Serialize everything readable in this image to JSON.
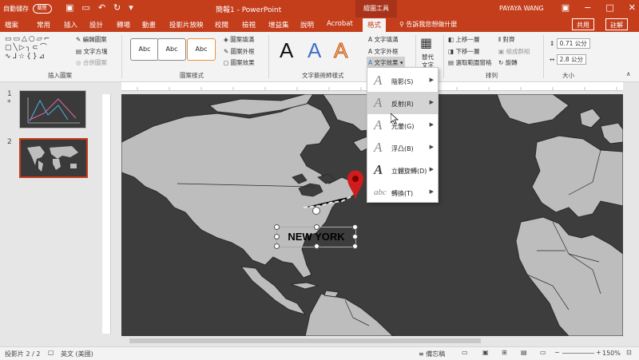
{
  "titlebar": {
    "autosave_label": "自動儲存",
    "autosave_state": "關閉",
    "doc_title": "簡報1  -  PowerPoint",
    "context_tab": "繪圖工具",
    "user": "PAYAYA WANG"
  },
  "tabs": [
    "檔案",
    "常用",
    "插入",
    "設計",
    "轉場",
    "動畫",
    "投影片放映",
    "校閱",
    "檢視",
    "增益集",
    "說明",
    "Acrobat",
    "格式"
  ],
  "active_tab": "格式",
  "tell_me": "告訴我您想做什麼",
  "share_label": "共用",
  "comment_label": "註解",
  "ribbon": {
    "insert_shapes": {
      "edit_shape": "編輯圖案",
      "text_box": "文字方塊",
      "merge_shapes": "合併圖案",
      "label": "插入圖案"
    },
    "shape_styles": {
      "sample": "Abc",
      "fill": "圖案填滿",
      "outline": "圖案外框",
      "effects": "圖案效果",
      "label": "圖案樣式"
    },
    "wordart": {
      "sample": "A",
      "text_fill": "文字填滿",
      "text_outline": "文字外框",
      "text_effects": "文字效果",
      "label": "文字藝術師樣式"
    },
    "accessibility": {
      "alt_text_1": "替代",
      "alt_text_2": "文字"
    },
    "arrange": {
      "bring_forward": "上移一層",
      "send_backward": "下移一層",
      "selection_pane": "選取範圍窗格",
      "align": "對齊",
      "group": "組成群組",
      "rotate": "旋轉",
      "label": "排列"
    },
    "size": {
      "height": "0.71 公分",
      "width": "2.8 公分",
      "label": "大小"
    }
  },
  "effects_menu": [
    {
      "label": "陰影(S)"
    },
    {
      "label": "反射(R)"
    },
    {
      "label": "光暈(G)"
    },
    {
      "label": "浮凸(B)"
    },
    {
      "label": "立體旋轉(D)"
    },
    {
      "label": "轉換(T)"
    }
  ],
  "slides": [
    {
      "number": "1",
      "marker": "*"
    },
    {
      "number": "2"
    }
  ],
  "slide_label": "NEW YORK",
  "status": {
    "slide_info": "投影片 2 / 2",
    "language": "英文 (美國)",
    "notes": "備忘稿",
    "zoom": "150%"
  },
  "colors": {
    "accent": "#c43e1c",
    "map_land": "#bdbdbd",
    "map_sea": "#3d3d3d",
    "pin": "#d01c1c"
  }
}
